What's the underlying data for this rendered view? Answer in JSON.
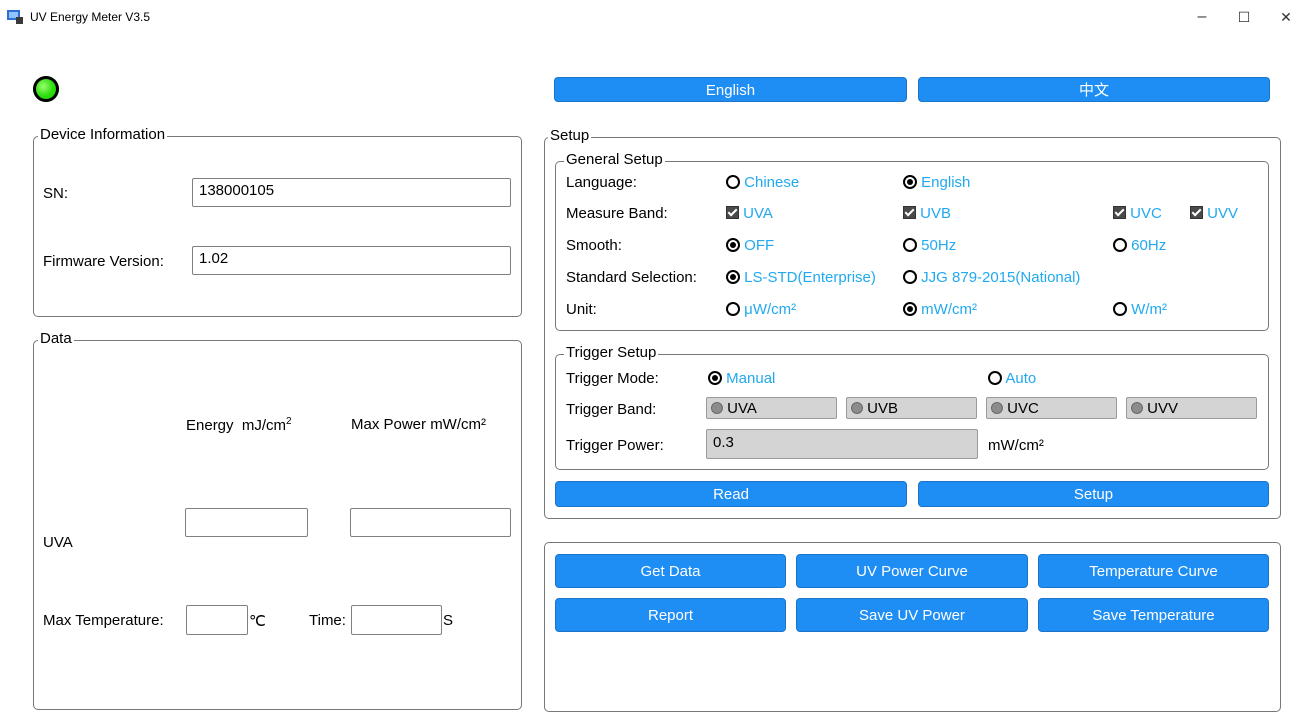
{
  "window": {
    "title": "UV Energy Meter V3.5",
    "minimize": "–",
    "maximize": "☐",
    "close": "✕"
  },
  "language_buttons": {
    "english": "English",
    "chinese": "中文"
  },
  "device_info": {
    "legend": "Device Information",
    "sn_label": "SN:",
    "sn_value": "138000105",
    "fw_label": "Firmware Version:",
    "fw_value": "1.02"
  },
  "data": {
    "legend": "Data",
    "energy_header": "Energy  mJ/cm",
    "energy_sup": "2",
    "power_header": "Max Power mW/cm²",
    "uva_label": "UVA",
    "uva_energy": "",
    "uva_power": "",
    "max_temp_label": "Max Temperature:",
    "max_temp_value": "",
    "temp_unit": "℃",
    "time_label": "Time:",
    "time_value": "",
    "time_unit": "S"
  },
  "setup": {
    "legend": "Setup",
    "general": {
      "legend": "General Setup",
      "language_label": "Language:",
      "language_options": [
        "Chinese",
        "English"
      ],
      "language_selected": "English",
      "band_label": "Measure Band:",
      "band_options": [
        "UVA",
        "UVB",
        "UVC",
        "UVV"
      ],
      "smooth_label": "Smooth:",
      "smooth_options": [
        "OFF",
        "50Hz",
        "60Hz"
      ],
      "smooth_selected": "OFF",
      "standard_label": "Standard Selection:",
      "standard_options": [
        "LS-STD(Enterprise)",
        "JJG 879-2015(National)"
      ],
      "standard_selected": "LS-STD(Enterprise)",
      "unit_label": "Unit:",
      "unit_options": [
        "μW/cm²",
        "mW/cm²",
        "W/m²"
      ],
      "unit_selected": "mW/cm²"
    },
    "trigger": {
      "legend": "Trigger Setup",
      "mode_label": "Trigger Mode:",
      "mode_options": [
        "Manual",
        "Auto"
      ],
      "mode_selected": "Manual",
      "band_label": "Trigger Band:",
      "band_options": [
        "UVA",
        "UVB",
        "UVC",
        "UVV"
      ],
      "power_label": "Trigger Power:",
      "power_value": "0.3",
      "power_unit": "mW/cm²"
    },
    "read_button": "Read",
    "setup_button": "Setup"
  },
  "actions": {
    "get_data": "Get Data",
    "uv_power_curve": "UV Power Curve",
    "temperature_curve": "Temperature Curve",
    "report": "Report",
    "save_uv_power": "Save UV Power",
    "save_temperature": "Save Temperature"
  },
  "colors": {
    "accent": "#1e8ef5",
    "option_text": "#21a9f0",
    "led": "#1cc700"
  }
}
